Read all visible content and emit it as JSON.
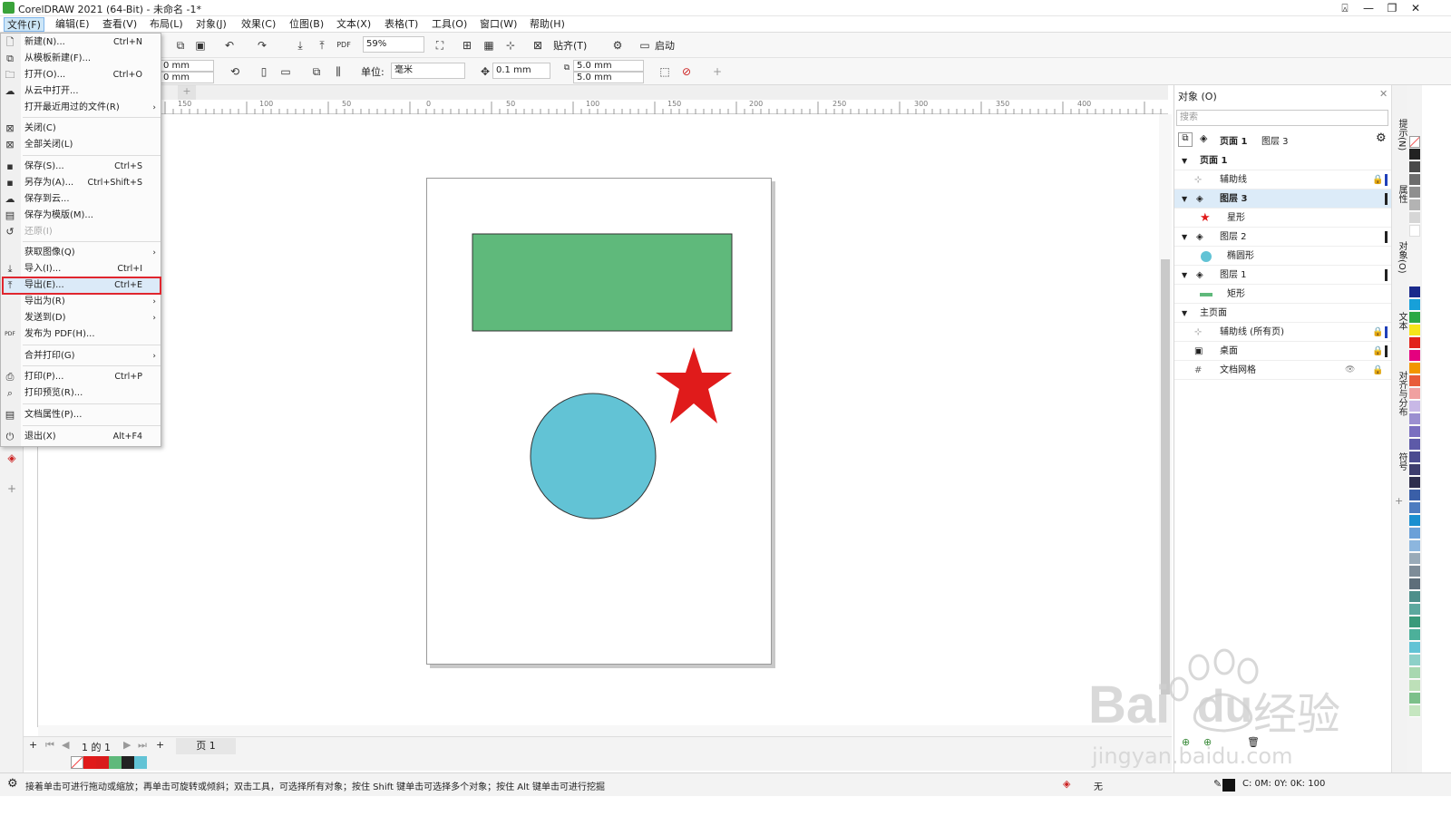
{
  "app": {
    "title": "CorelDRAW 2021 (64-Bit) - 未命名 -1*"
  },
  "menubar": {
    "items": [
      "文件(F)",
      "编辑(E)",
      "查看(V)",
      "布局(L)",
      "对象(J)",
      "效果(C)",
      "位图(B)",
      "文本(X)",
      "表格(T)",
      "工具(O)",
      "窗口(W)",
      "帮助(H)"
    ]
  },
  "toolbar1": {
    "zoom": "59%",
    "snap": "贴齐(T)",
    "launch": "启动"
  },
  "toolbar2": {
    "w1": "0 mm",
    "w2": "0 mm",
    "units_label": "单位:",
    "units": "毫米",
    "nudge": "0.1 mm",
    "dup_x": "5.0 mm",
    "dup_y": "5.0 mm"
  },
  "ruler_h": {
    "ticks": [
      "150",
      "100",
      "50",
      "0",
      "50",
      "100",
      "150",
      "200",
      "250",
      "300",
      "350",
      "400"
    ]
  },
  "file_menu": {
    "items": [
      {
        "label": "新建(N)...",
        "shortcut": "Ctrl+N",
        "icon": "new-doc-icon"
      },
      {
        "label": "从模板新建(F)...",
        "shortcut": "",
        "icon": "template-icon"
      },
      {
        "label": "打开(O)...",
        "shortcut": "Ctrl+O",
        "icon": "open-folder-icon"
      },
      {
        "label": "从云中打开...",
        "shortcut": "",
        "icon": "cloud-icon"
      },
      {
        "label": "打开最近用过的文件(R)",
        "shortcut": "",
        "icon": "",
        "submenu": true
      },
      {
        "label": "关闭(C)",
        "shortcut": "",
        "icon": "close-doc-icon"
      },
      {
        "label": "全部关闭(L)",
        "shortcut": "",
        "icon": "close-all-icon"
      },
      {
        "label": "保存(S)...",
        "shortcut": "Ctrl+S",
        "icon": "save-icon"
      },
      {
        "label": "另存为(A)...",
        "shortcut": "Ctrl+Shift+S",
        "icon": "save-as-icon"
      },
      {
        "label": "保存到云...",
        "shortcut": "",
        "icon": "cloud-save-icon"
      },
      {
        "label": "保存为模版(M)...",
        "shortcut": "",
        "icon": "save-template-icon"
      },
      {
        "label": "还原(I)",
        "shortcut": "",
        "icon": "revert-icon",
        "disabled": true
      },
      {
        "label": "获取图像(Q)",
        "shortcut": "",
        "icon": "",
        "submenu": true
      },
      {
        "label": "导入(I)...",
        "shortcut": "Ctrl+I",
        "icon": "import-icon"
      },
      {
        "label": "导出(E)...",
        "shortcut": "Ctrl+E",
        "icon": "export-icon"
      },
      {
        "label": "导出为(R)",
        "shortcut": "",
        "icon": "",
        "submenu": true
      },
      {
        "label": "发送到(D)",
        "shortcut": "",
        "icon": "",
        "submenu": true
      },
      {
        "label": "发布为 PDF(H)...",
        "shortcut": "",
        "icon": "pdf-icon"
      },
      {
        "label": "合并打印(G)",
        "shortcut": "",
        "icon": "",
        "submenu": true
      },
      {
        "label": "打印(P)...",
        "shortcut": "Ctrl+P",
        "icon": "print-icon"
      },
      {
        "label": "打印预览(R)...",
        "shortcut": "",
        "icon": "print-preview-icon"
      },
      {
        "label": "文档属性(P)...",
        "shortcut": "",
        "icon": "doc-props-icon"
      },
      {
        "label": "退出(X)",
        "shortcut": "Alt+F4",
        "icon": "power-icon"
      }
    ]
  },
  "page_nav": {
    "count": "1 的 1",
    "tab": "页 1"
  },
  "object_panel": {
    "title": "对象 (O)",
    "search_placeholder": "搜索",
    "crumb_page": "页面 1",
    "crumb_layer": "图层 3",
    "rows": [
      {
        "label": "页面 1",
        "level": 0,
        "expand": "▼"
      },
      {
        "label": "辅助线",
        "level": 1,
        "lock": "lock-icon"
      },
      {
        "label": "图层 3",
        "level": 1,
        "expand": "▼",
        "selected": true
      },
      {
        "label": "星形",
        "level": 2,
        "shape": "star"
      },
      {
        "label": "图层 2",
        "level": 1,
        "expand": "▼"
      },
      {
        "label": "椭圆形",
        "level": 2,
        "shape": "circle"
      },
      {
        "label": "图层 1",
        "level": 1,
        "expand": "▼"
      },
      {
        "label": "矩形",
        "level": 2,
        "shape": "rect"
      },
      {
        "label": "主页面",
        "level": 0,
        "expand": "▼"
      },
      {
        "label": "辅助线 (所有页)",
        "level": 1,
        "lock": "lock-icon"
      },
      {
        "label": "桌面",
        "level": 1,
        "lock": "lock-icon"
      },
      {
        "label": "文档网格",
        "level": 1
      }
    ]
  },
  "right_tabs": [
    "提示(N)",
    "属性",
    "对象(O)",
    "文本",
    "对齐与分布",
    "符号"
  ],
  "statusbar": {
    "hint": "接着单击可进行拖动或缩放；再单击可旋转或倾斜；双击工具，可选择所有对象；按住 Shift 键单击可选择多个对象；按住 Alt 键单击可进行挖掘",
    "fill_label": "无",
    "color": "C: 0M: 0Y: 0K: 100"
  },
  "shapes_colors": {
    "rect": "#5fb97b",
    "circle": "#62c3d5",
    "star": "#e01b1b"
  },
  "watermark": {
    "text1": "Bai",
    "text2": "du",
    "text3": "经验",
    "url": "jingyan.baidu.com"
  }
}
